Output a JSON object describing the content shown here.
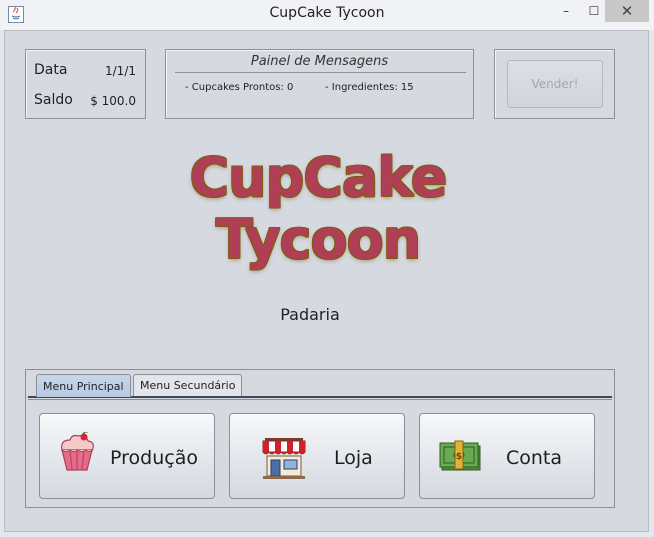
{
  "window": {
    "title": "CupCake Tycoon",
    "minimize": "–",
    "maximize": "☐",
    "close": "✕"
  },
  "status": {
    "date_label": "Data",
    "date_value": "1/1/1",
    "balance_label": "Saldo",
    "balance_value": "$ 100.0"
  },
  "messages": {
    "title": "Painel de Mensagens",
    "items": [
      "- Cupcakes Prontos: 0",
      "- Ingredientes: 15"
    ]
  },
  "sell_button": {
    "label": "Vender!",
    "enabled": false
  },
  "logo": {
    "line1": "CupCake",
    "line2": "Tycoon"
  },
  "subtitle": "Padaria",
  "tabs": [
    {
      "label": "Menu Principal",
      "active": true
    },
    {
      "label": "Menu Secundário",
      "active": false
    }
  ],
  "main_buttons": [
    {
      "label": "Produção",
      "icon": "cupcake-icon"
    },
    {
      "label": "Loja",
      "icon": "store-icon"
    },
    {
      "label": "Conta",
      "icon": "money-icon"
    }
  ],
  "colors": {
    "logo_fill": "#b03e57",
    "logo_outline": "#f4d33c",
    "window_bg": "#d6d9e0",
    "tab_active": "#b8c9e2"
  }
}
